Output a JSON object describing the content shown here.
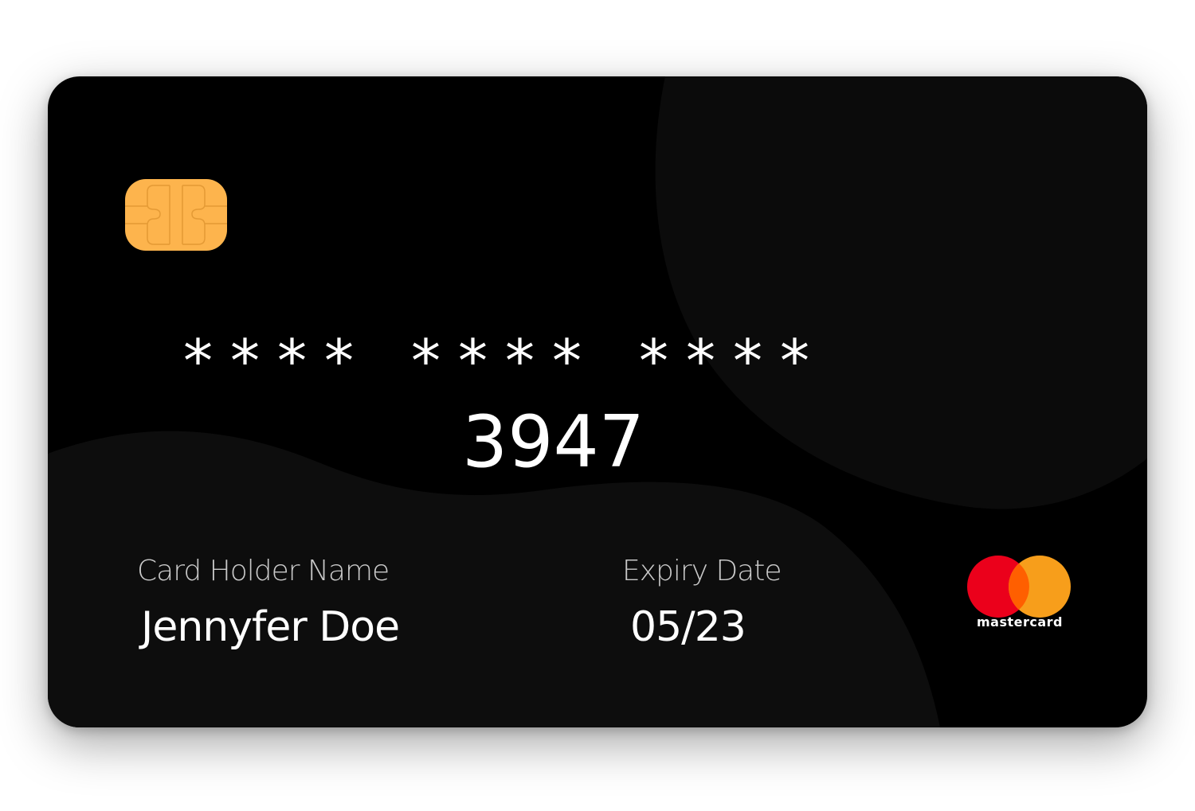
{
  "card": {
    "masked_groups": [
      "****",
      "****",
      "****"
    ],
    "last_digits": "3947",
    "holder_label": "Card Holder Name",
    "holder_name": "Jennyfer Doe",
    "expiry_label": "Expiry Date",
    "expiry_value": "05/23",
    "brand_name": "mastercard"
  },
  "colors": {
    "card_background": "#000000",
    "wave_shade": "#0d0d0d",
    "chip": "#fdb44d",
    "brand_red": "#eb001b",
    "brand_orange": "#f79e1b",
    "brand_overlap": "#ff5f00"
  },
  "icons": {
    "chip": "emv-chip-icon",
    "brand": "mastercard-logo-icon"
  }
}
